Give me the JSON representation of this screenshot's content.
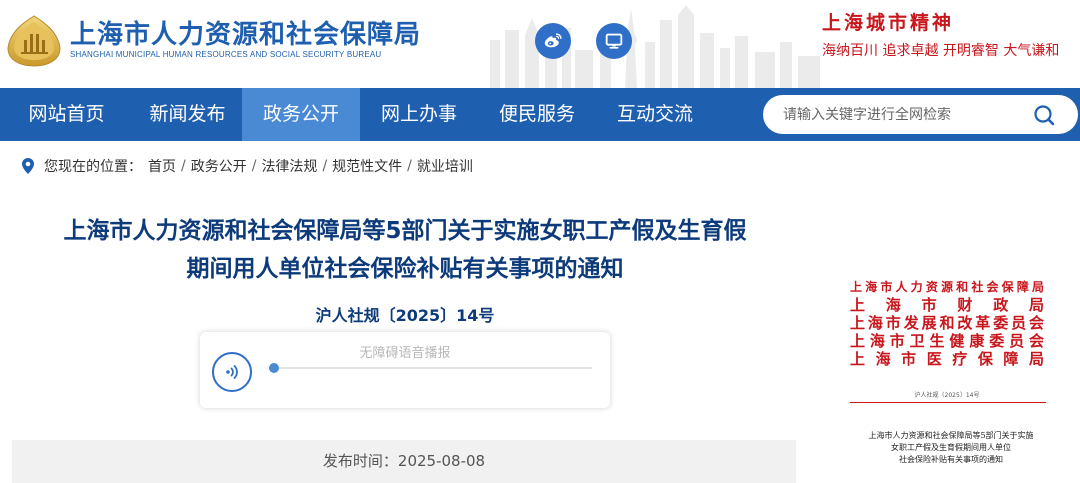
{
  "header": {
    "title": "上海市人力资源和社会保障局",
    "subtitle": "SHANGHAI MUNICIPAL HUMAN RESOURCES AND SOCIAL SECURITY BUREAU",
    "weibo_icon": "weibo-icon",
    "screen_icon": "monitor-icon",
    "slogan_title": "上海城市精神",
    "slogan_text": "海纳百川 追求卓越 开明睿智 大气谦和"
  },
  "nav": {
    "items": [
      {
        "label": "网站首页"
      },
      {
        "label": "新闻发布"
      },
      {
        "label": "政务公开",
        "active": true
      },
      {
        "label": "网上办事"
      },
      {
        "label": "便民服务"
      },
      {
        "label": "互动交流"
      }
    ],
    "search": {
      "placeholder": "请输入关键字进行全网检索",
      "value": ""
    }
  },
  "breadcrumb": {
    "label": "您现在的位置：",
    "items": [
      "首页",
      "政务公开",
      "法律法规",
      "规范性文件",
      "就业培训"
    ]
  },
  "article": {
    "title_line1": "上海市人力资源和社会保障局等5部门关于实施女职工产假及生育假",
    "title_line2": "期间用人单位社会保险补贴有关事项的通知",
    "doc_number": "沪人社规〔2025〕14号",
    "player_label": "无障碍语音播报",
    "player_progress": 0.0,
    "publish": "发布时间：2025-08-08"
  },
  "doc_preview": {
    "issuers": [
      "上海市人力资源和社会保障局",
      "上海市财政局",
      "上海市发展和改革委员会",
      "上海市卫生健康委员会",
      "上海市医疗保障局"
    ],
    "number": "沪人社规〔2025〕14号",
    "caption_lines": [
      "上海市人力资源和社会保障局等5部门关于实施",
      "女职工产假及生育假期间用人单位",
      "社会保险补贴有关事项的通知"
    ]
  },
  "colors": {
    "brand_blue": "#1f5fb0",
    "nav_active": "#4a8ad4",
    "title_blue": "#0d3a7a",
    "slogan_red": "#c8161d"
  }
}
